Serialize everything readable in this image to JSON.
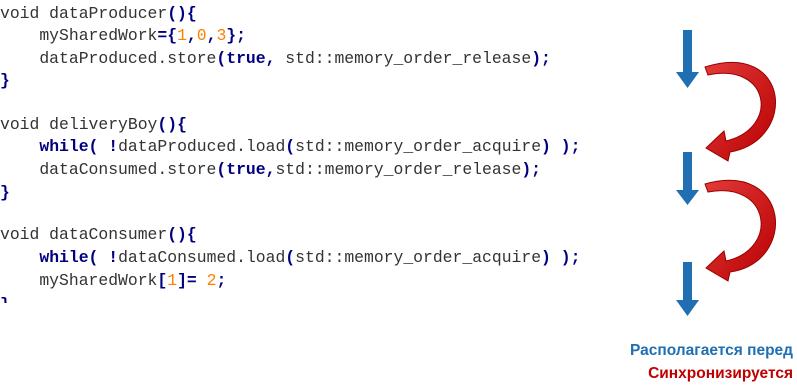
{
  "code": {
    "lines": [
      [
        {
          "t": "void dataProducer",
          "c": "plain"
        },
        {
          "t": "(){",
          "c": "bold"
        }
      ],
      [
        {
          "t": "    mySharedWork",
          "c": "plain"
        },
        {
          "t": "={",
          "c": "bold"
        },
        {
          "t": "1",
          "c": "num"
        },
        {
          "t": ",",
          "c": "bold"
        },
        {
          "t": "0",
          "c": "num"
        },
        {
          "t": ",",
          "c": "bold"
        },
        {
          "t": "3",
          "c": "num"
        },
        {
          "t": "};",
          "c": "bold"
        }
      ],
      [
        {
          "t": "    dataProduced.store",
          "c": "plain"
        },
        {
          "t": "(true,",
          "c": "bold"
        },
        {
          "t": " std::memory_order_release",
          "c": "plain"
        },
        {
          "t": ");",
          "c": "bold"
        }
      ],
      [
        {
          "t": "}",
          "c": "bold"
        }
      ],
      [],
      [
        {
          "t": "void deliveryBoy",
          "c": "plain"
        },
        {
          "t": "(){",
          "c": "bold"
        }
      ],
      [
        {
          "t": "    ",
          "c": "plain"
        },
        {
          "t": "while(",
          "c": "kw"
        },
        {
          "t": " ",
          "c": "plain"
        },
        {
          "t": "!",
          "c": "bold"
        },
        {
          "t": "dataProduced.load",
          "c": "plain"
        },
        {
          "t": "(",
          "c": "bold"
        },
        {
          "t": "std::memory_order_acquire",
          "c": "plain"
        },
        {
          "t": ")",
          "c": "bold"
        },
        {
          "t": " ",
          "c": "plain"
        },
        {
          "t": ");",
          "c": "bold"
        }
      ],
      [
        {
          "t": "    dataConsumed.store",
          "c": "plain"
        },
        {
          "t": "(true,",
          "c": "bold"
        },
        {
          "t": "std::memory_order_release",
          "c": "plain"
        },
        {
          "t": ");",
          "c": "bold"
        }
      ],
      [
        {
          "t": "}",
          "c": "bold"
        }
      ],
      [],
      [
        {
          "t": "void dataConsumer",
          "c": "plain"
        },
        {
          "t": "(){",
          "c": "bold"
        }
      ],
      [
        {
          "t": "    ",
          "c": "plain"
        },
        {
          "t": "while(",
          "c": "kw"
        },
        {
          "t": " ",
          "c": "plain"
        },
        {
          "t": "!",
          "c": "bold"
        },
        {
          "t": "dataConsumed.load",
          "c": "plain"
        },
        {
          "t": "(",
          "c": "bold"
        },
        {
          "t": "std::memory_order_acquire",
          "c": "plain"
        },
        {
          "t": ")",
          "c": "bold"
        },
        {
          "t": " ",
          "c": "plain"
        },
        {
          "t": ");",
          "c": "bold"
        }
      ],
      [
        {
          "t": "    mySharedWork",
          "c": "plain"
        },
        {
          "t": "[",
          "c": "bold"
        },
        {
          "t": "1",
          "c": "num"
        },
        {
          "t": "]=",
          "c": "bold"
        },
        {
          "t": " ",
          "c": "plain"
        },
        {
          "t": "2",
          "c": "num"
        },
        {
          "t": ";",
          "c": "bold"
        }
      ],
      [
        {
          "t": "}",
          "c": "bold"
        }
      ]
    ]
  },
  "legend": {
    "before_label": "Располагается перед",
    "sync_label": "Синхронизируется"
  },
  "colors": {
    "before_arrow": "#1f6fb2",
    "sync_arrow": "#c00000",
    "keyword": "#000080",
    "number": "#ff8000",
    "plain": "#333333"
  }
}
